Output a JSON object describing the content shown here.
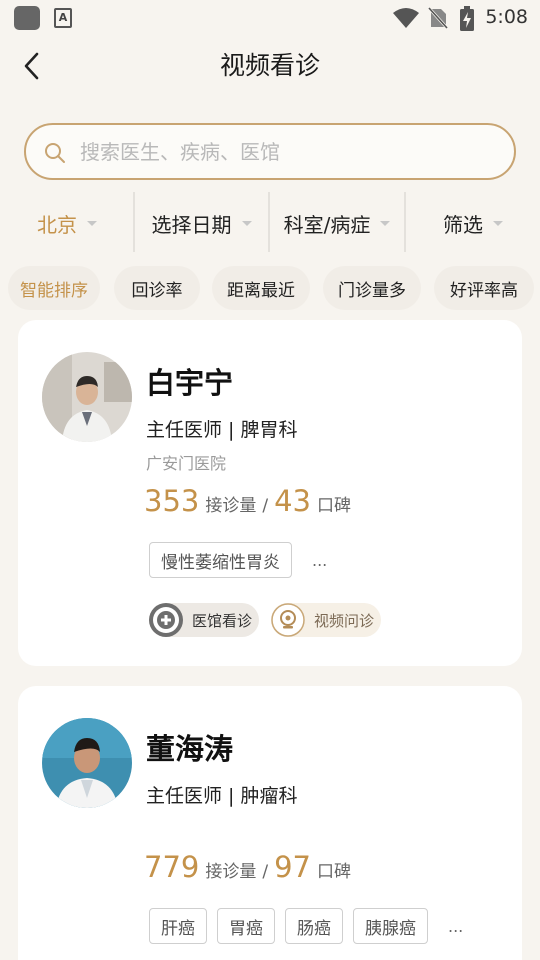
{
  "status_bar": {
    "time": "5:08",
    "app_icon_letter": "A"
  },
  "header": {
    "title": "视频看诊"
  },
  "search": {
    "placeholder": "搜索医生、疾病、医馆"
  },
  "filters": [
    {
      "label": "北京",
      "active": true
    },
    {
      "label": "选择日期",
      "active": false
    },
    {
      "label": "科室/病症",
      "active": false
    },
    {
      "label": "筛选",
      "active": false
    }
  ],
  "sort_chips": [
    {
      "label": "智能排序",
      "active": true
    },
    {
      "label": "回诊率",
      "active": false
    },
    {
      "label": "距离最近",
      "active": false
    },
    {
      "label": "门诊量多",
      "active": false
    },
    {
      "label": "好评率高",
      "active": false
    }
  ],
  "doctors": [
    {
      "name": "白宇宁",
      "title_dept": "主任医师 | 脾胃科",
      "hospital": "广安门医院",
      "consults": "353",
      "consults_label": "接诊量",
      "slash": "/",
      "rating": "43",
      "rating_label": "口碑",
      "tags": [
        "慢性萎缩性胃炎"
      ],
      "more": "...",
      "services": [
        "医馆看诊",
        "视频问诊"
      ]
    },
    {
      "name": "董海涛",
      "title_dept": "主任医师 | 肿瘤科",
      "hospital": "",
      "consults": "779",
      "consults_label": "接诊量",
      "slash": "/",
      "rating": "97",
      "rating_label": "口碑",
      "tags": [
        "肝癌",
        "胃癌",
        "肠癌",
        "胰腺癌"
      ],
      "more": "..."
    }
  ],
  "colors": {
    "accent": "#c4924a",
    "search_border": "#c8a472",
    "background": "#f7f4ef"
  }
}
